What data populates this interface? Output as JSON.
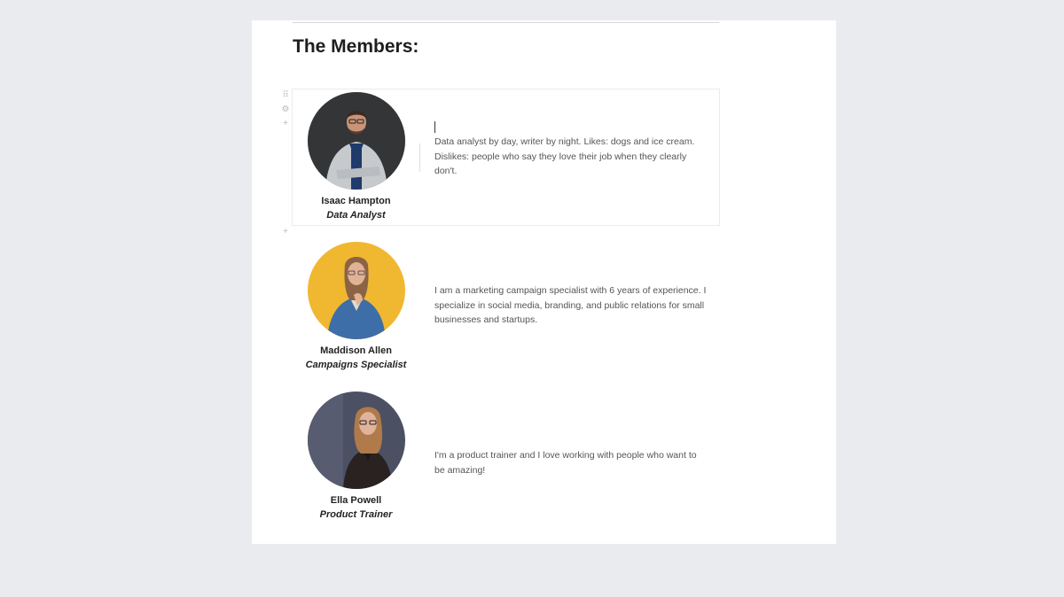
{
  "page": {
    "title": "The Members:"
  },
  "members": [
    {
      "name": "Isaac Hampton",
      "role": "Data Analyst",
      "bio": "Data analyst by day, writer by night. Likes: dogs and ice cream. Dislikes: people who say they love their job when they clearly don't.",
      "photo_bg": "#2f3133",
      "photo_icon": "man-portrait"
    },
    {
      "name": "Maddison Allen",
      "role": "Campaigns Specialist",
      "bio": "I am a marketing campaign specialist with 6 years of experience. I specialize in social media, branding, and public relations for small businesses and startups.",
      "photo_bg": "#f0b830",
      "photo_icon": "woman-portrait"
    },
    {
      "name": "Ella Powell",
      "role": "Product Trainer",
      "bio": "I'm a product trainer and I love working with people who want to be amazing!",
      "photo_bg": "#4b5063",
      "photo_icon": "woman-portrait"
    }
  ],
  "handles": {
    "drag": "⠿",
    "settings": "⚙",
    "add": "+"
  },
  "colors": {
    "background": "#e9ebef",
    "page": "#ffffff",
    "text": "#222222",
    "bio_text": "#555555"
  }
}
